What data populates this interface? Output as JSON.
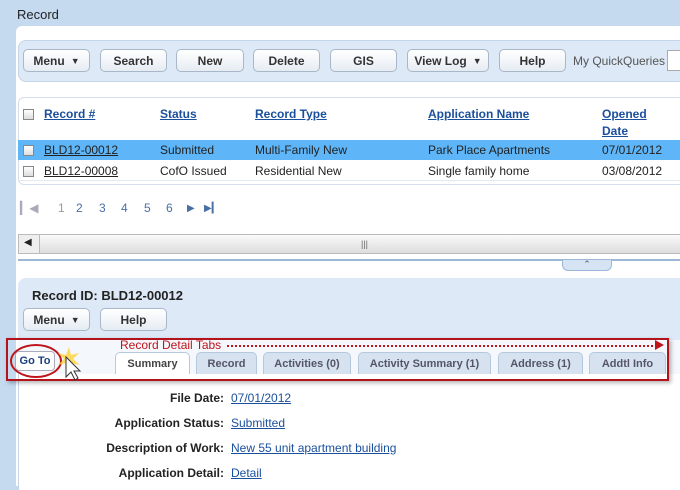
{
  "window": {
    "title": "Record"
  },
  "toolbar": {
    "buttons": [
      "Menu",
      "Search",
      "New",
      "Delete",
      "GIS",
      "View Log",
      "Help"
    ],
    "quickqueries_label": "My QuickQueries"
  },
  "grid": {
    "columns": [
      "Record #",
      "Status",
      "Record Type",
      "Application Name",
      "Opened",
      "Date"
    ],
    "rows": [
      {
        "record": "BLD12-00012",
        "status": "Submitted",
        "type": "Multi-Family New",
        "name": "Park Place Apartments",
        "opened": "07/01/2012",
        "selected": true
      },
      {
        "record": "BLD12-00008",
        "status": "CofO Issued",
        "type": "Residential New",
        "name": "Single family home",
        "opened": "03/08/2012",
        "selected": false
      }
    ]
  },
  "pager": {
    "pages": [
      "1",
      "2",
      "3",
      "4",
      "5",
      "6"
    ],
    "current": "1"
  },
  "detail": {
    "record_id": "Record ID: BLD12-00012",
    "buttons": [
      "Menu",
      "Help"
    ],
    "goto": "Go To",
    "callout": "Record Detail Tabs",
    "tabs": [
      "Summary",
      "Record",
      "Activities (0)",
      "Activity Summary (1)",
      "Address (1)",
      "Addtl Info"
    ],
    "active_tab": "Summary",
    "fields": [
      {
        "label": "File Date:",
        "value": "07/01/2012"
      },
      {
        "label": "Application Status:",
        "value": "Submitted"
      },
      {
        "label": "Description of Work:",
        "value": "New 55 unit apartment building"
      },
      {
        "label": "Application Detail:",
        "value": "Detail"
      }
    ]
  },
  "colors": {
    "selected_row": "#5eb5f7",
    "callout": "#c0141b",
    "link": "#1a4f9c"
  }
}
